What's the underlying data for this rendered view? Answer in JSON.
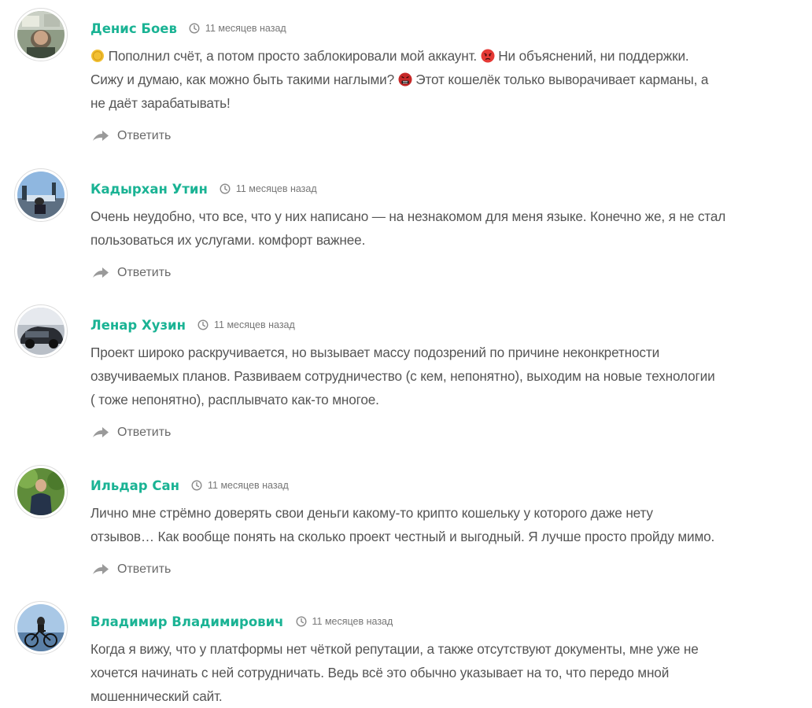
{
  "comments": [
    {
      "author": "Денис Боев",
      "time": "11 месяцев назад",
      "lines": [
        [
          "coin-emoji",
          " Пополнил счёт, а потом просто заблокировали мой аккаунт. ",
          "angry-face-emoji",
          " Ни объяснений, ни поддержки."
        ],
        [
          "Сижу и думаю, как можно быть такими наглыми? ",
          "cursing-face-emoji",
          " Этот кошелёк только выворачивает карманы, а"
        ],
        [
          "не даёт зарабатывать!"
        ]
      ],
      "reply_label": "Ответить"
    },
    {
      "author": "Кадырхан Утин",
      "time": "11 месяцев назад",
      "lines": [
        [
          "Очень неудобно, что все, что у них написано — на незнакомом для меня языке. Конечно же, я не стал"
        ],
        [
          "пользоваться их услугами. комфорт важнее."
        ]
      ],
      "reply_label": "Ответить"
    },
    {
      "author": "Ленар Хузин",
      "time": "11 месяцев назад",
      "lines": [
        [
          "Проект широко раскручивается, но вызывает массу подозрений по причине неконкретности"
        ],
        [
          "озвучиваемых планов. Развиваем сотрудничество (с кем, непонятно), выходим на новые технологии"
        ],
        [
          "( тоже непонятно), расплывчато как-то многое."
        ]
      ],
      "reply_label": "Ответить"
    },
    {
      "author": "Ильдар Сан",
      "time": "11 месяцев назад",
      "lines": [
        [
          "Лично мне стрёмно доверять свои деньги какому-то крипто кошельку у которого даже нету"
        ],
        [
          "отзывов… Как вообще понять на сколько проект честный и выгодный. Я лучше просто пройду мимо."
        ]
      ],
      "reply_label": "Ответить"
    },
    {
      "author": "Владимир Владимирович",
      "time": "11 месяцев назад",
      "lines": [
        [
          "Когда я вижу, что у платформы нет чёткой репутации, а также отсутствуют документы, мне уже не"
        ],
        [
          "хочется начинать с ней сотрудничать. Ведь всё это обычно указывает на то, что передо мной"
        ],
        [
          "мошеннический сайт."
        ]
      ]
    }
  ],
  "icons": {
    "clock": "clock-icon",
    "reply": "reply-arrow-icon"
  },
  "colors": {
    "author": "#1ab394",
    "text": "#555555",
    "muted": "#777777"
  }
}
